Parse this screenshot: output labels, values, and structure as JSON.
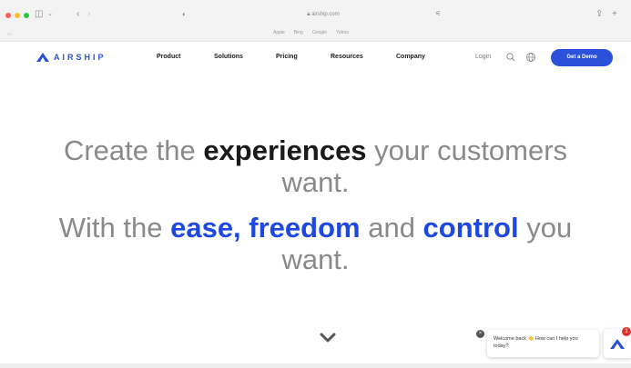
{
  "browser": {
    "url": "airship.com",
    "favorites": [
      "Apple",
      "Bing",
      "Google",
      "Yahoo"
    ],
    "icons": [
      "close-light",
      "minimize-light",
      "zoom-light",
      "sidebar-icon",
      "back-icon",
      "forward-icon",
      "privacy-shield-icon",
      "lock-icon",
      "share-icon",
      "new-tab-icon"
    ],
    "traffic_colors": [
      "#ff5f57",
      "#febc2e",
      "#28c840"
    ]
  },
  "nav": {
    "logo_text": "AIRSHIP",
    "items": [
      "Product",
      "Solutions",
      "Pricing",
      "Resources",
      "Company"
    ],
    "login": "Login",
    "demo_button": "Get a Demo",
    "icons": [
      "search-icon",
      "globe-icon"
    ],
    "accent": "#2b50d9"
  },
  "hero": {
    "line1": {
      "pre": "Create the ",
      "bold": "experiences",
      "post": " your customers"
    },
    "line1b": "want.",
    "line2": {
      "pre": "With the ",
      "blue1": "ease, freedom",
      "mid": " and ",
      "blue2": "control",
      "post": " you"
    },
    "line2b": "want.",
    "colors": {
      "muted": "#8a8a8a",
      "dark": "#1a1a1a",
      "blue": "#1f48e0"
    }
  },
  "chat": {
    "message": "Welcome back 👋 How can I help you today?",
    "badge": "1"
  }
}
